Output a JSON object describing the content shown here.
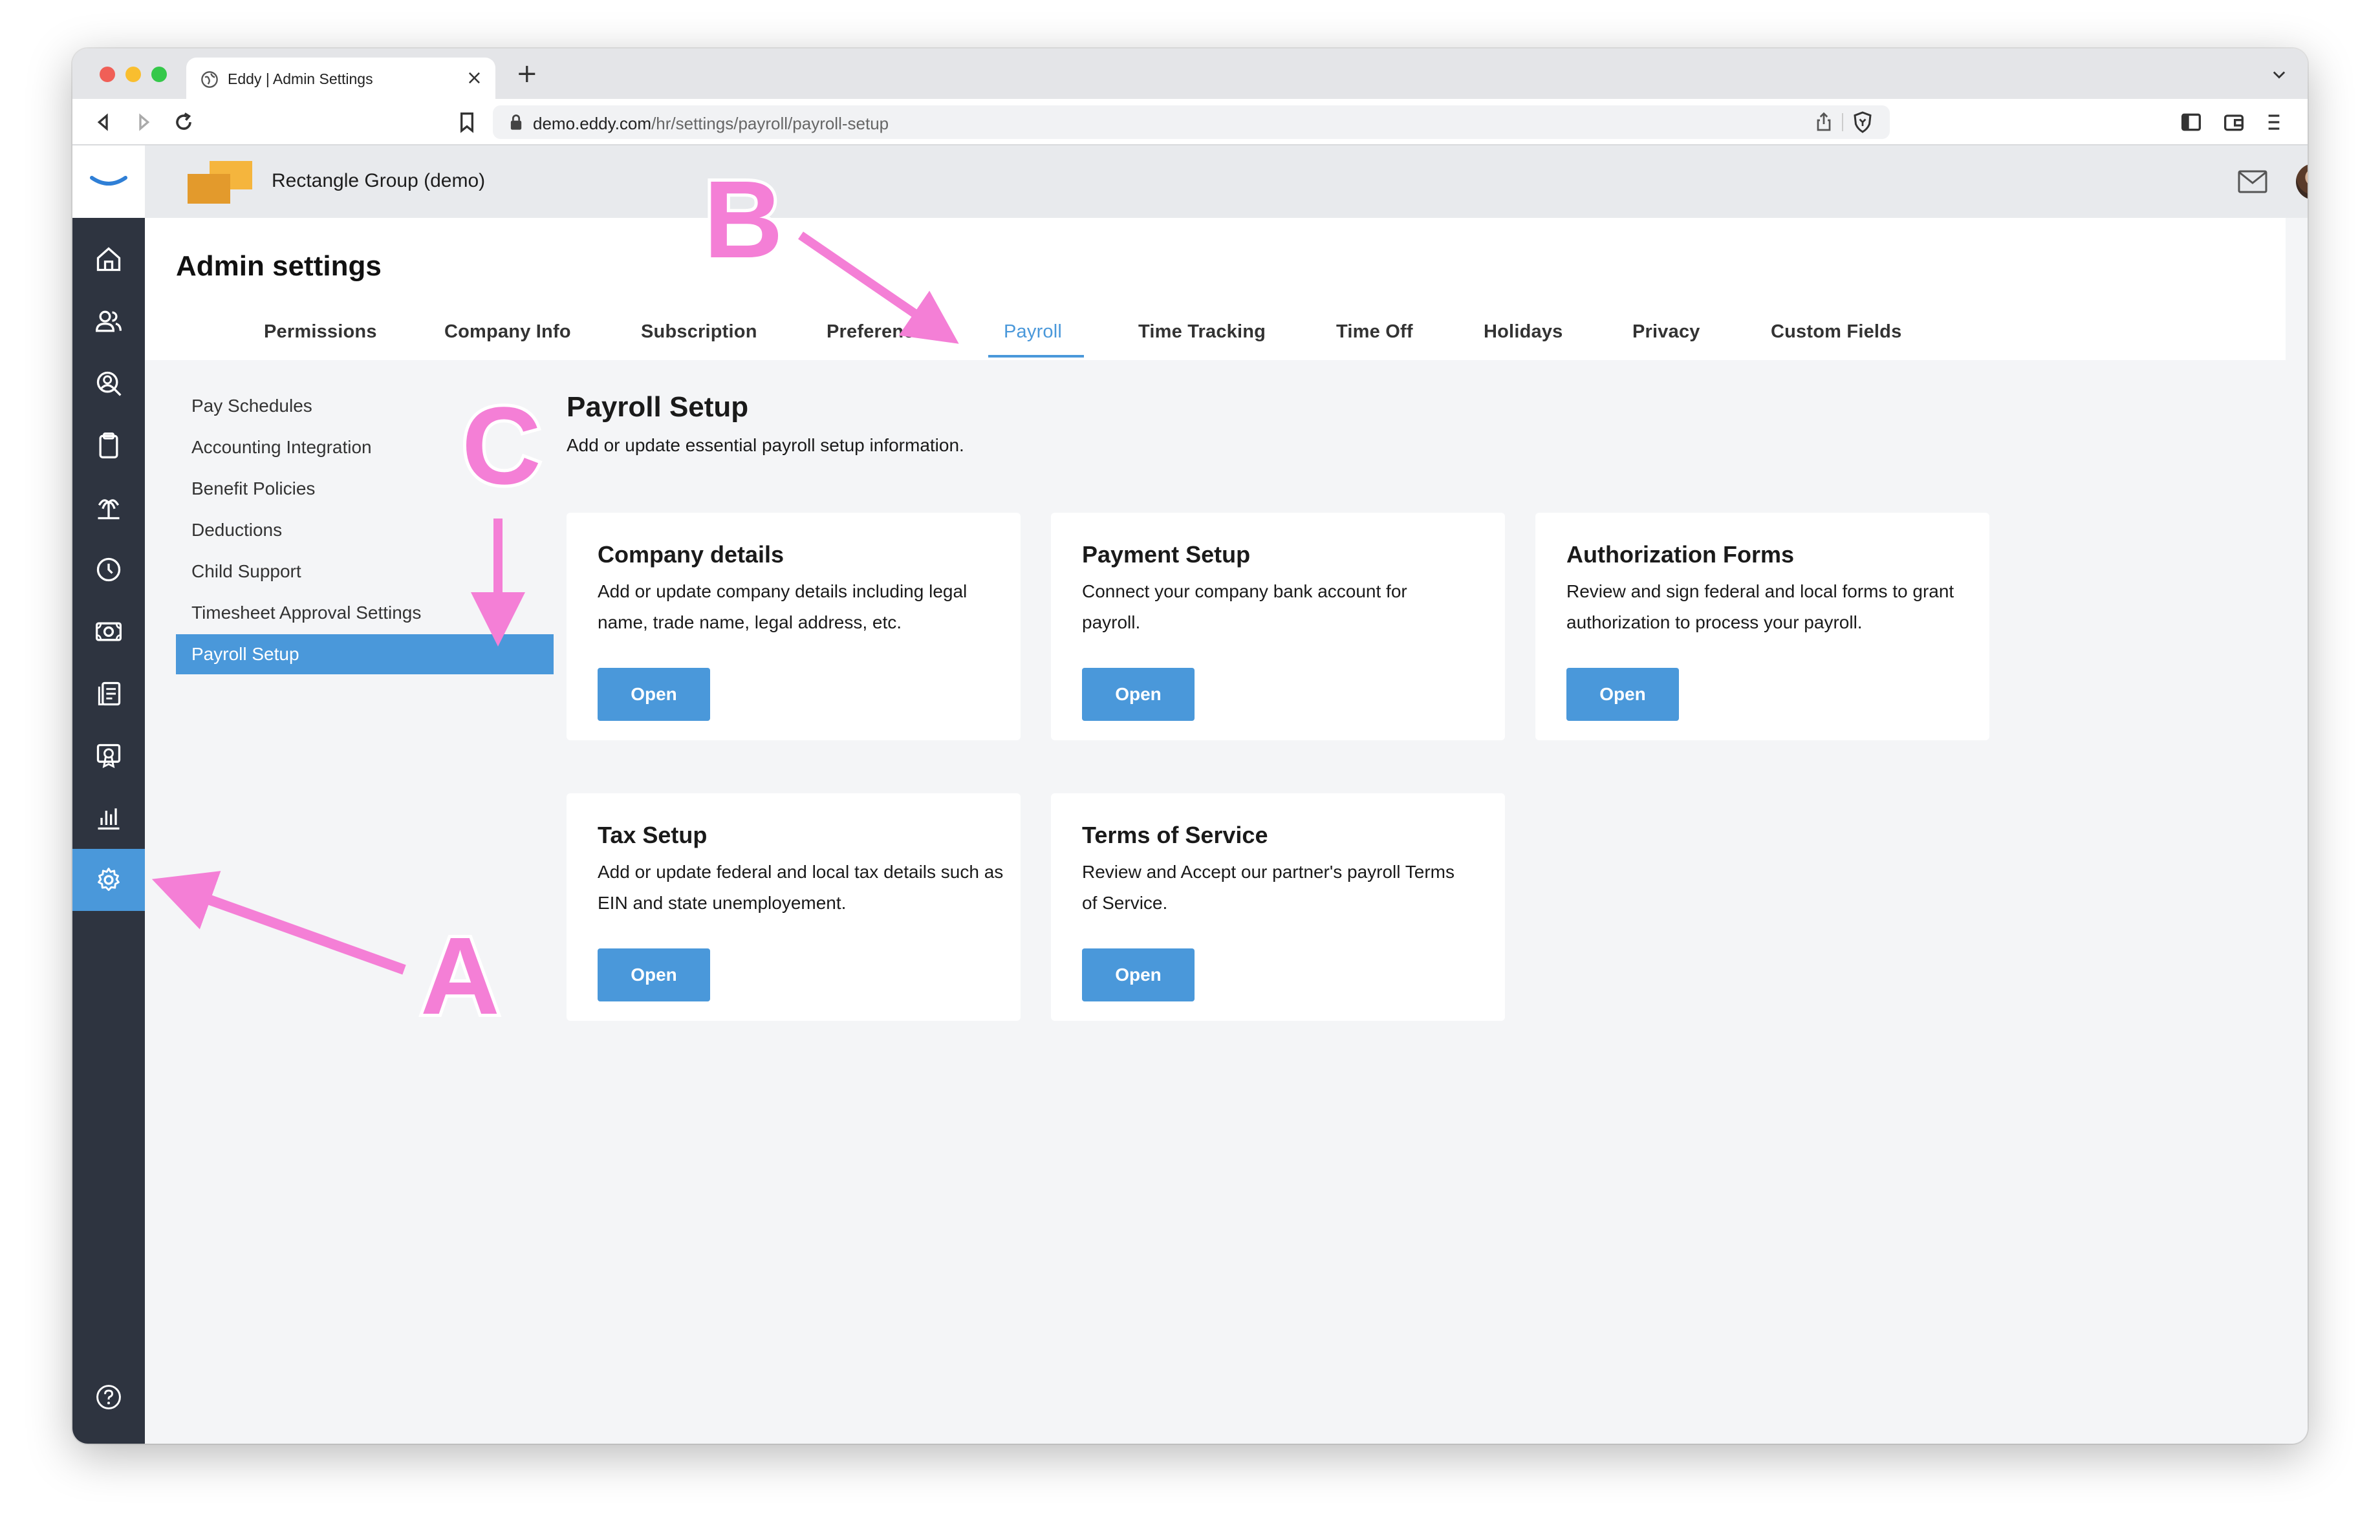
{
  "browser": {
    "tab_title": "Eddy | Admin Settings",
    "tab_close": "×",
    "new_tab": "+",
    "url_host": "demo.eddy.com",
    "url_path": "/hr/settings/payroll/payroll-setup"
  },
  "topbar": {
    "company_name": "Rectangle Group (demo)"
  },
  "sidebar": {
    "items": [
      {
        "icon": "home-icon"
      },
      {
        "icon": "people-icon"
      },
      {
        "icon": "search-person-icon"
      },
      {
        "icon": "clipboard-icon"
      },
      {
        "icon": "palm-tree-icon"
      },
      {
        "icon": "clock-icon"
      },
      {
        "icon": "money-icon"
      },
      {
        "icon": "documents-icon"
      },
      {
        "icon": "certificate-icon"
      },
      {
        "icon": "reports-icon"
      },
      {
        "icon": "gear-icon",
        "active": true
      }
    ],
    "help_icon": "help-icon"
  },
  "header": {
    "title": "Admin settings",
    "tabs": [
      {
        "label": "Permissions"
      },
      {
        "label": "Company Info"
      },
      {
        "label": "Subscription"
      },
      {
        "label": "Preferences"
      },
      {
        "label": "Payroll",
        "active": true
      },
      {
        "label": "Time Tracking"
      },
      {
        "label": "Time Off"
      },
      {
        "label": "Holidays"
      },
      {
        "label": "Privacy"
      },
      {
        "label": "Custom Fields"
      }
    ]
  },
  "subnav": {
    "items": [
      {
        "label": "Pay Schedules"
      },
      {
        "label": "Accounting Integration"
      },
      {
        "label": "Benefit Policies"
      },
      {
        "label": "Deductions"
      },
      {
        "label": "Child Support"
      },
      {
        "label": "Timesheet Approval Settings"
      },
      {
        "label": "Payroll Setup",
        "active": true
      }
    ]
  },
  "main": {
    "title": "Payroll Setup",
    "subtitle": "Add or update essential payroll setup information.",
    "cards": [
      {
        "title": "Company details",
        "desc": "Add or update company details including legal name, trade name, legal address, etc.",
        "button": "Open"
      },
      {
        "title": "Payment Setup",
        "desc": "Connect your company bank account for payroll.",
        "button": "Open"
      },
      {
        "title": "Authorization Forms",
        "desc": "Review and sign federal and local forms to grant authorization to process your payroll.",
        "button": "Open"
      },
      {
        "title": "Tax Setup",
        "desc": "Add or update federal and local tax details such as EIN and state unemployement.",
        "button": "Open"
      },
      {
        "title": "Terms of Service",
        "desc": "Review and Accept our partner's payroll Terms of Service.",
        "button": "Open"
      }
    ]
  },
  "annotations": {
    "a": "A",
    "b": "B",
    "c": "C",
    "color": "#f47fd6"
  },
  "colors": {
    "accent": "#4a98da",
    "sidebar": "#2e3440"
  }
}
